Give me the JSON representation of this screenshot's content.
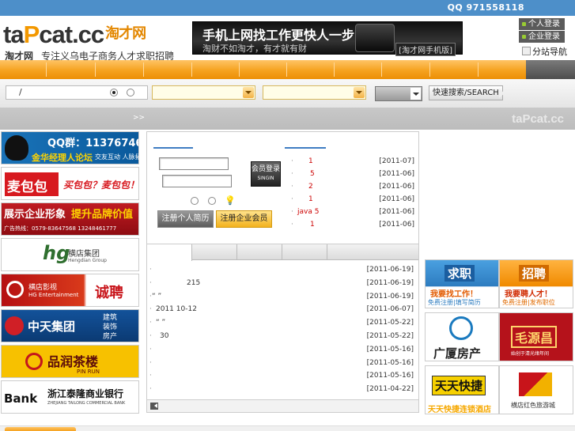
{
  "topbar": {
    "qq": "QQ  971558118"
  },
  "header": {
    "logo_text": "ta",
    "logo_cat": "P",
    "logo_rest": "cat.cc",
    "logo_cn": "淘才网",
    "slogan_brand": "淘才网",
    "slogan": "专注义乌电子商务人才求职招聘",
    "banner_line1": "手机上网找工作更快人一步",
    "banner_line2": "淘财不如淘才，有才就有财",
    "banner_tag": "[淘才网手机版]",
    "login_personal": "个人登录",
    "login_company": "企业登录",
    "subnav": "分站导航"
  },
  "search": {
    "keyword_value": "/",
    "button": "快速搜索/SEARCH",
    "bar_arrow": ">>",
    "watermark": "taPcat.cc"
  },
  "left_ads": [
    {
      "line1": "QQ群：113767461",
      "line2": "金华经理人论坛",
      "line3": "交友互动 人脉拓展"
    },
    {
      "line1": "麦包包",
      "line2": "买包包？麦包包！"
    },
    {
      "line1": "展示企业形象",
      "line2": "提升品牌价值",
      "line3": "广告热线：0579-83647568 13248461777"
    },
    {
      "line1": "hg",
      "line2": "横店集团",
      "line3": "Hengdian Group"
    },
    {
      "line1": "横店影视",
      "line2": "HG Entertainment",
      "line3": "诚聘"
    },
    {
      "line1": "中天集团",
      "line2": "建筑",
      "line3": "装饰",
      "line4": "房产"
    },
    {
      "line1": "品润茶楼",
      "line2": "PIN RUN"
    },
    {
      "line1": "Bank",
      "line2": "浙江泰隆商业银行",
      "line3": "ZHEJIANG TAILONG COMMERCIAL BANK"
    }
  ],
  "login": {
    "member_login_line1": "会员登录",
    "member_login_line2": "SINGIN",
    "reg_personal": "注册个人简历",
    "reg_company": "注册企业会员"
  },
  "news": [
    {
      "title": "1",
      "date": "[2011-07]"
    },
    {
      "title": "5",
      "date": "[2011-06]"
    },
    {
      "title": "2",
      "date": "[2011-06]"
    },
    {
      "title": "1",
      "date": "[2011-06]"
    },
    {
      "title": "java    5",
      "date": "[2011-06]"
    },
    {
      "title": "1",
      "date": "[2011-06]"
    }
  ],
  "list": [
    {
      "title": "",
      "date": "[2011-06-19]"
    },
    {
      "title": "215",
      "date": "[2011-06-19]"
    },
    {
      "title": "“  ”",
      "date": "[2011-06-19]"
    },
    {
      "title": "2011            10-12",
      "date": "[2011-06-07]"
    },
    {
      "title": "“  ”",
      "date": "[2011-05-22]"
    },
    {
      "title": "30",
      "date": "[2011-05-22]"
    },
    {
      "title": "",
      "date": "[2011-05-16]"
    },
    {
      "title": "",
      "date": "[2011-05-16]"
    },
    {
      "title": "",
      "date": "[2011-05-16]"
    },
    {
      "title": "",
      "date": "[2011-04-22]"
    }
  ],
  "right_ads": [
    {
      "title": "求职",
      "sub1": "我要找工作！",
      "sub2": "免费注册|填写简历"
    },
    {
      "title": "招聘",
      "sub1": "我要聘人才！",
      "sub2": "免费注册|发布职位"
    },
    {
      "title": "广厦房产"
    },
    {
      "title": "毛源昌",
      "sub1": "始创于清光绪年间"
    },
    {
      "title": "天天快捷",
      "sub1": "天天快捷连锁酒店"
    },
    {
      "title": "横店红色旅游城"
    }
  ],
  "colors": {
    "nav_orange": "#f5a21f",
    "topbar_blue": "#4d8fc9",
    "tab_blue": "#3f7dc3",
    "news_red": "#cc0000"
  }
}
